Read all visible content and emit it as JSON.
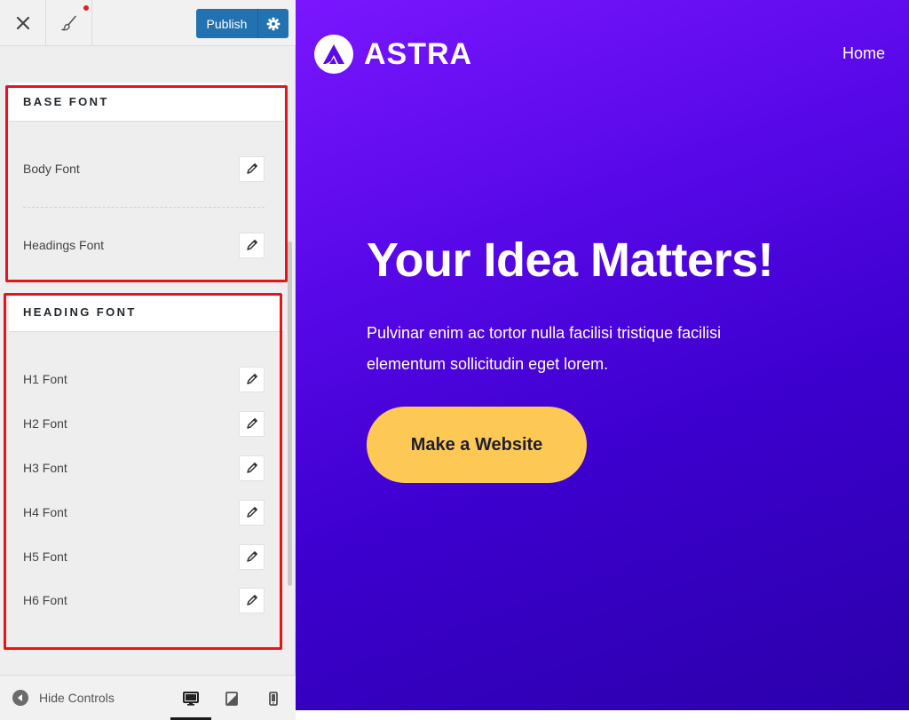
{
  "toolbar": {
    "publish_label": "Publish"
  },
  "sections": {
    "base_font": {
      "heading": "BASE FONT",
      "items": [
        {
          "label": "Body Font"
        },
        {
          "label": "Headings Font"
        }
      ]
    },
    "heading_font": {
      "heading": "HEADING FONT",
      "items": [
        {
          "label": "H1 Font"
        },
        {
          "label": "H2 Font"
        },
        {
          "label": "H3 Font"
        },
        {
          "label": "H4 Font"
        },
        {
          "label": "H5 Font"
        },
        {
          "label": "H6 Font"
        }
      ]
    }
  },
  "footer": {
    "hide_controls_label": "Hide Controls",
    "active_device": "desktop"
  },
  "preview": {
    "logo_text": "ASTRA",
    "nav": {
      "home": "Home"
    },
    "hero_title": "Your Idea Matters!",
    "hero_subtitle": "Pulvinar enim ac tortor nulla facilisi tristique facilisi elementum sollicitudin eget lorem.",
    "cta_label": "Make a Website"
  },
  "colors": {
    "publish_blue": "#2271b1",
    "highlight_red": "#e8141a",
    "hero_gradient_start": "#7a16ff",
    "hero_gradient_end": "#2a00aa",
    "cta_yellow": "#fdc854"
  },
  "icons": {
    "close": "close-icon",
    "brush": "brush-icon",
    "settings": "gear-icon",
    "edit": "pencil-icon",
    "hide": "arrow-left-circle-icon",
    "desktop": "desktop-icon",
    "tablet": "tablet-icon",
    "mobile": "mobile-icon"
  }
}
